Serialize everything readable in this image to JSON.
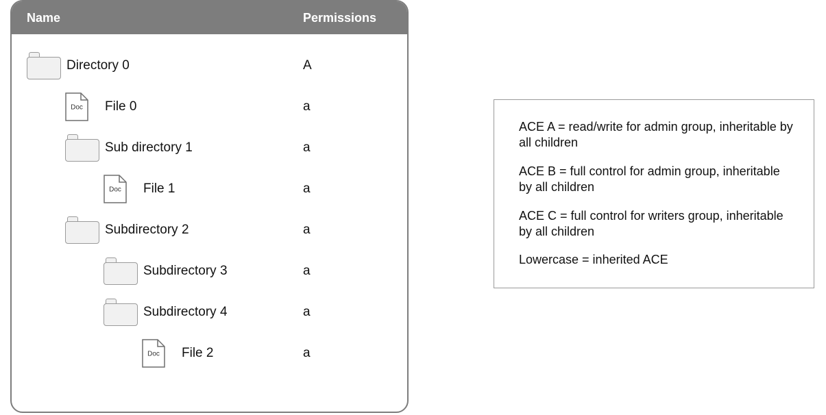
{
  "header": {
    "name_col": "Name",
    "perm_col": "Permissions"
  },
  "rows": [
    {
      "indent": 0,
      "icon": "folder",
      "label": "Directory 0",
      "perm": "A"
    },
    {
      "indent": 1,
      "icon": "doc",
      "label": "File 0",
      "perm": "a"
    },
    {
      "indent": 1,
      "icon": "folder",
      "label": "Sub directory 1",
      "perm": "a"
    },
    {
      "indent": 2,
      "icon": "doc",
      "label": "File 1",
      "perm": "a"
    },
    {
      "indent": 1,
      "icon": "folder",
      "label": "Subdirectory 2",
      "perm": "a"
    },
    {
      "indent": 2,
      "icon": "folder",
      "label": "Subdirectory 3",
      "perm": "a"
    },
    {
      "indent": 2,
      "icon": "folder",
      "label": "Subdirectory 4",
      "perm": "a"
    },
    {
      "indent": 3,
      "icon": "doc",
      "label": "File 2",
      "perm": "a"
    }
  ],
  "legend": {
    "lines": [
      "ACE A = read/write for admin group, inheritable by all children",
      "ACE B = full control for admin group, inheritable by all children",
      "ACE C = full control for writers group, inheritable by all children",
      "Lowercase = inherited ACE"
    ]
  },
  "icons": {
    "doc_label": "Doc"
  }
}
